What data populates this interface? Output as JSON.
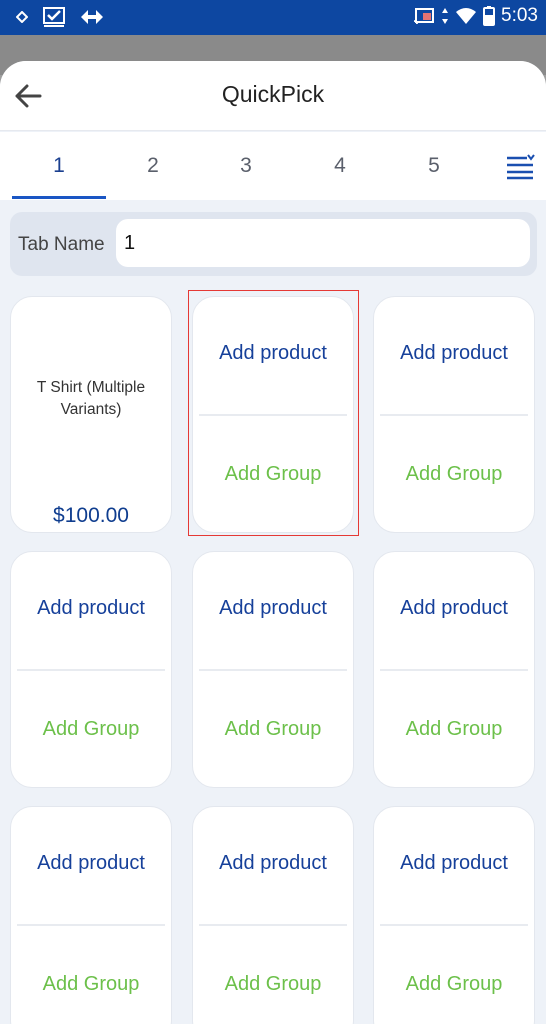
{
  "status_bar": {
    "time": "5:03"
  },
  "header": {
    "title": "QuickPick"
  },
  "tabs": [
    {
      "label": "1"
    },
    {
      "label": "2"
    },
    {
      "label": "3"
    },
    {
      "label": "4"
    },
    {
      "label": "5"
    }
  ],
  "tab_name": {
    "label": "Tab Name",
    "value": "1"
  },
  "cards": [
    {
      "type": "product",
      "name": "T Shirt (Multiple Variants)",
      "price": "$100.00"
    },
    {
      "type": "empty",
      "add_product": "Add product",
      "add_group": "Add Group"
    },
    {
      "type": "empty",
      "add_product": "Add product",
      "add_group": "Add Group"
    },
    {
      "type": "empty",
      "add_product": "Add product",
      "add_group": "Add Group"
    },
    {
      "type": "empty",
      "add_product": "Add product",
      "add_group": "Add Group"
    },
    {
      "type": "empty",
      "add_product": "Add product",
      "add_group": "Add Group"
    },
    {
      "type": "empty",
      "add_product": "Add product",
      "add_group": "Add Group"
    },
    {
      "type": "empty",
      "add_product": "Add product",
      "add_group": "Add Group"
    },
    {
      "type": "empty",
      "add_product": "Add product",
      "add_group": "Add Group"
    }
  ],
  "colors": {
    "brand_blue": "#16409a",
    "group_green": "#6cc04a",
    "status_bar": "#0d47a1"
  }
}
